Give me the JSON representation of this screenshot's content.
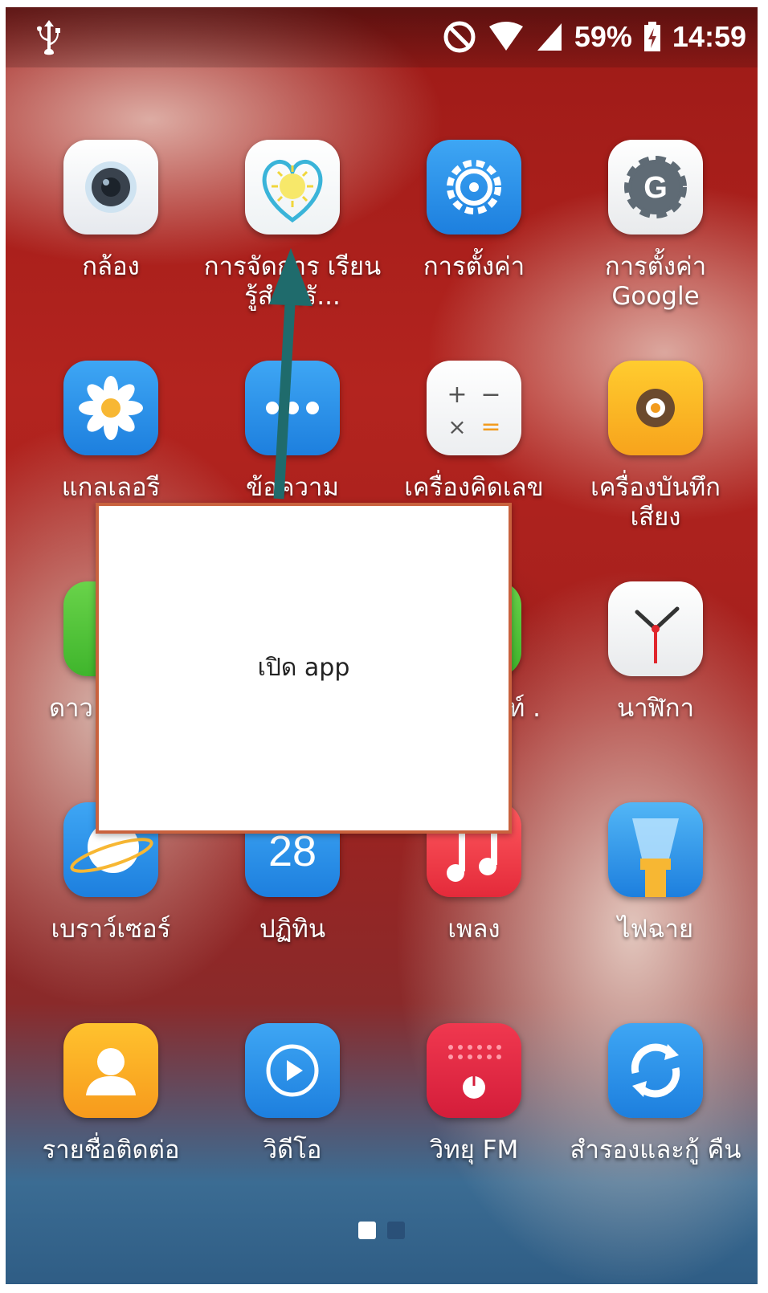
{
  "statusbar": {
    "battery": "59%",
    "time": "14:59"
  },
  "apps": [
    {
      "label": "กล้อง",
      "icon": "camera-icon"
    },
    {
      "label": "การจัดการ เรียนรู้สำหรั...",
      "icon": "heart-sun-icon"
    },
    {
      "label": "การตั้งค่า",
      "icon": "settings-gear-icon"
    },
    {
      "label": "การตั้งค่า Google",
      "icon": "google-settings-icon"
    },
    {
      "label": "แกลเลอรี",
      "icon": "gallery-flower-icon"
    },
    {
      "label": "ข้อความ",
      "icon": "messages-icon"
    },
    {
      "label": "เครื่องคิดเลข",
      "icon": "calculator-icon"
    },
    {
      "label": "เครื่องบันทึก เสียง",
      "icon": "voice-recorder-icon"
    },
    {
      "label": "ดาว",
      "icon": "downloads-icon"
    },
    {
      "label": "ท์ .",
      "icon": "hidden-app-icon"
    },
    {
      "label": "นาฬิกา",
      "icon": "clock-icon"
    },
    {
      "label": "เบราว์เซอร์",
      "icon": "browser-icon"
    },
    {
      "label": "ปฏิทิน",
      "icon": "calendar-icon"
    },
    {
      "label": "เพลง",
      "icon": "music-icon"
    },
    {
      "label": "ไฟฉาย",
      "icon": "flashlight-icon"
    },
    {
      "label": "รายชื่อติดต่อ",
      "icon": "contacts-icon"
    },
    {
      "label": "วิดีโอ",
      "icon": "video-icon"
    },
    {
      "label": "วิทยุ FM",
      "icon": "fm-radio-icon"
    },
    {
      "label": "สำรองและกู้ คืน",
      "icon": "backup-restore-icon"
    }
  ],
  "calendar_day": "28",
  "dialog": {
    "text": "เปิด app"
  },
  "page_indicator": {
    "pages": 2,
    "active": 1
  }
}
